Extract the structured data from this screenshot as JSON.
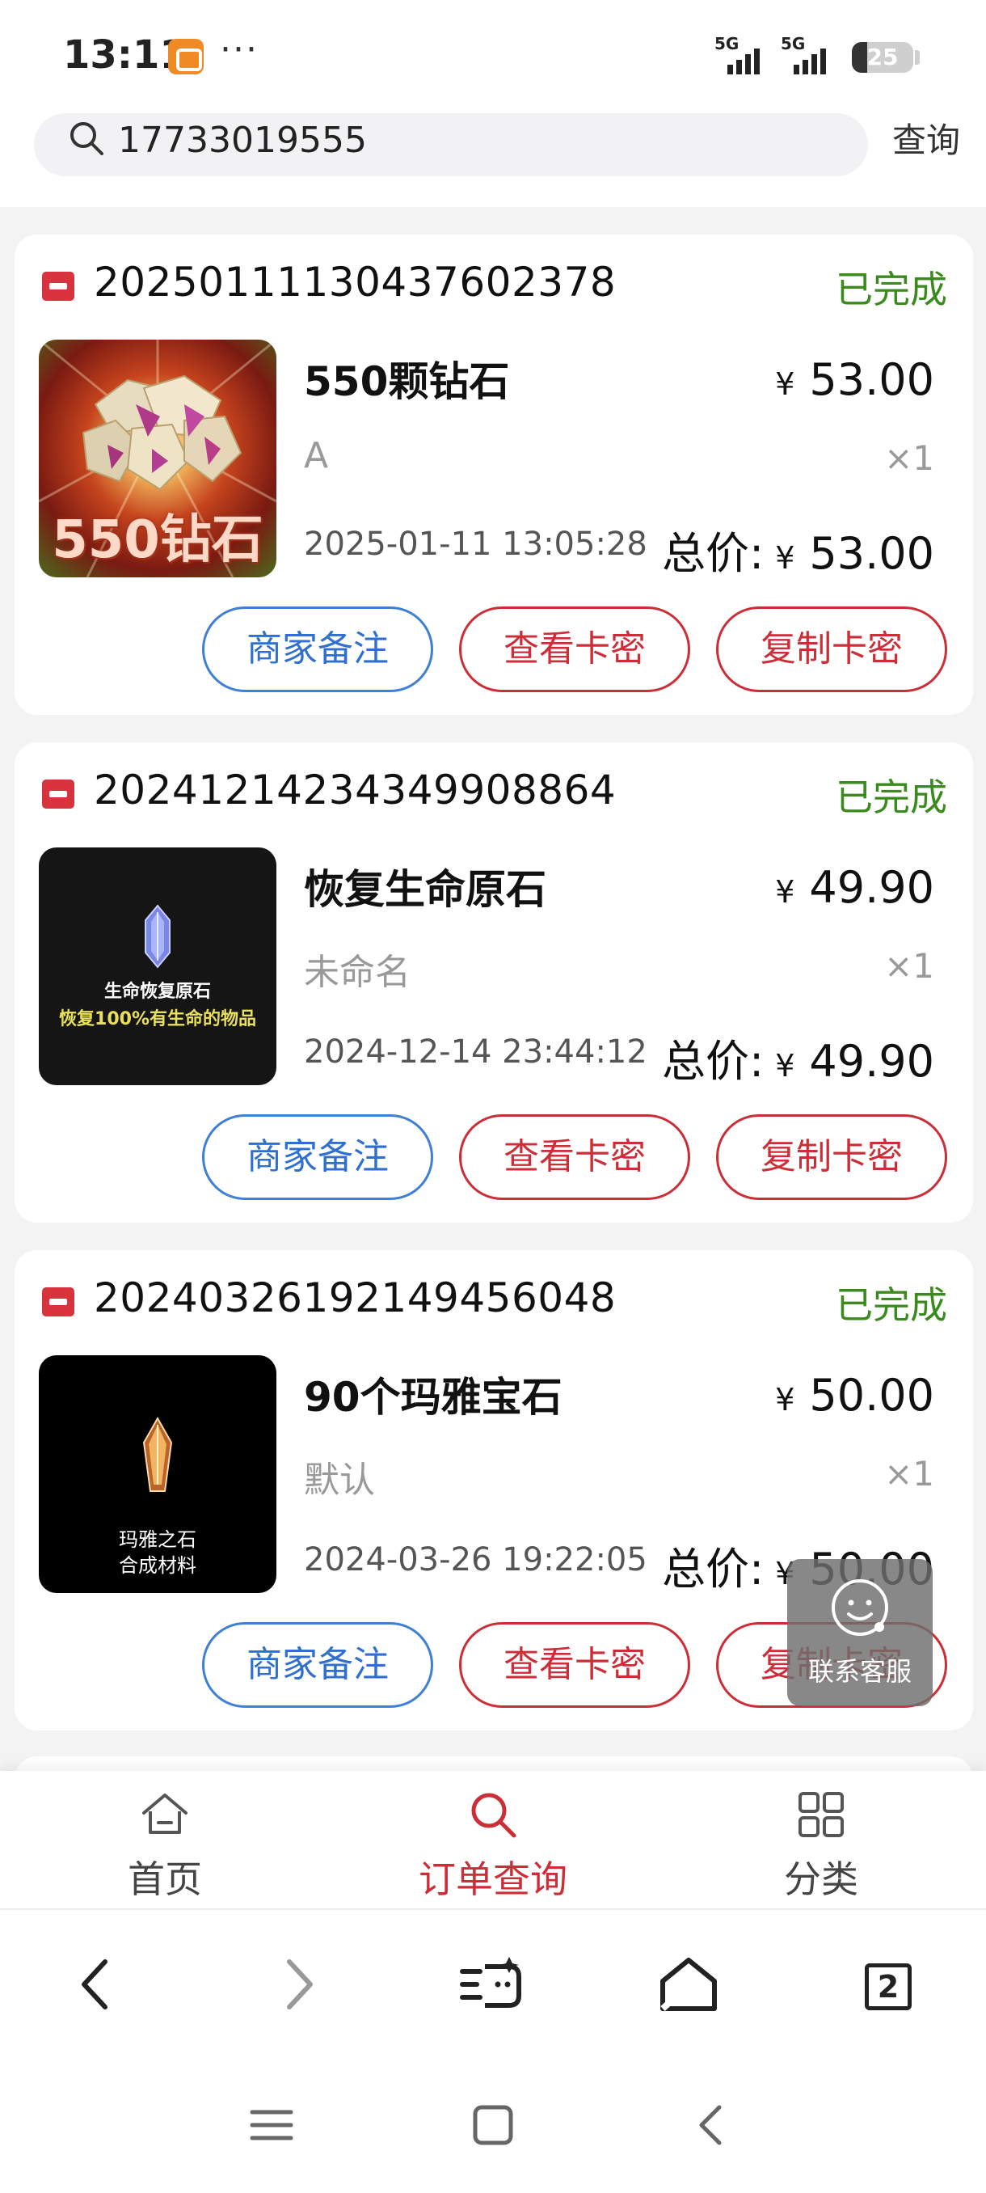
{
  "status_bar": {
    "time": "13:11",
    "more": "···",
    "signal1": "5G",
    "signal2": "5G",
    "battery": "25",
    "battery_level": 0.25
  },
  "search": {
    "value": "17733019555",
    "button": "查询"
  },
  "orders": [
    {
      "order_no": "20250111130437602378",
      "status": "已完成",
      "product_name": "550颗钻石",
      "price": "53.00",
      "spec": "A",
      "qty": "×1",
      "time": "2025-01-11 13:05:28",
      "total_label": "总价:",
      "total": "53.00",
      "image_text": "550钻石"
    },
    {
      "order_no": "20241214234349908864",
      "status": "已完成",
      "product_name": "恢复生命原石",
      "price": "49.90",
      "spec": "未命名",
      "qty": "×1",
      "time": "2024-12-14 23:44:12",
      "total_label": "总价:",
      "total": "49.90",
      "image_text_1": "生命恢复原石",
      "image_text_2": "恢复100%有生命的物品"
    },
    {
      "order_no": "20240326192149456048",
      "status": "已完成",
      "product_name": "90个玛雅宝石",
      "price": "50.00",
      "spec": "默认",
      "qty": "×1",
      "time": "2024-03-26 19:22:05",
      "total_label": "总价:",
      "total": "50.00",
      "image_text_1": "玛雅之石",
      "image_text_2": "合成材料"
    }
  ],
  "currency": "¥",
  "buttons": {
    "merchant_note": "商家备注",
    "view_card": "查看卡密",
    "copy_card": "复制卡密"
  },
  "float_service": {
    "label": "联系客服"
  },
  "tab_nav": {
    "home": "首页",
    "orders": "订单查询",
    "category": "分类"
  },
  "browser": {
    "tabs_count": "2"
  },
  "colors": {
    "accent_red": "#cc2e38",
    "status_green": "#3a8a1e",
    "accent_blue": "#2f6fcf"
  }
}
